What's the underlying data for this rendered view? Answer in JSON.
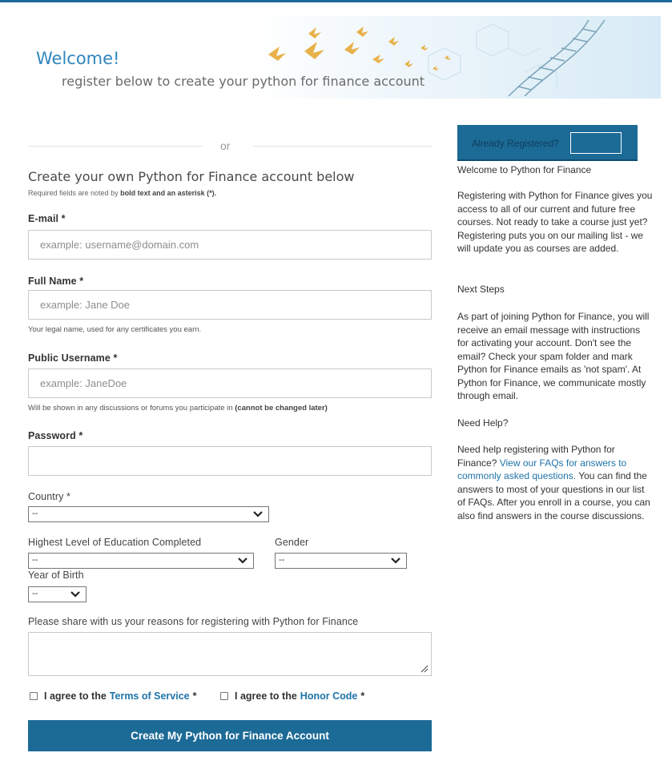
{
  "banner": {
    "welcome": "Welcome!",
    "tagline": "register below to create your python for finance account"
  },
  "divider": {
    "or": "or"
  },
  "form": {
    "title": "Create your own Python for Finance account below",
    "required_note_pre": "Required fields are noted by ",
    "required_note_bold": "bold text and an asterisk (*).",
    "email": {
      "label": "E-mail *",
      "placeholder": "example: username@domain.com",
      "value": ""
    },
    "full_name": {
      "label": "Full Name *",
      "placeholder": "example: Jane Doe",
      "value": "",
      "hint": "Your legal name, used for any certificates you earn."
    },
    "username": {
      "label": "Public Username *",
      "placeholder": "example: JaneDoe",
      "value": "",
      "hint_pre": "Will be shown in any discussions or forums you participate in ",
      "hint_bold": "(cannot be changed later)"
    },
    "password": {
      "label": "Password *",
      "value": ""
    },
    "country": {
      "label": "Country *",
      "selected": "--"
    },
    "education": {
      "label": "Highest Level of Education Completed",
      "selected": "--"
    },
    "gender": {
      "label": "Gender",
      "selected": "--"
    },
    "year_of_birth": {
      "label": "Year of Birth",
      "selected": "--"
    },
    "reasons": {
      "label": "Please share with us your reasons for registering with Python for Finance",
      "value": ""
    },
    "terms": {
      "pre": "I agree to the",
      "link": "Terms of Service",
      "post": "*"
    },
    "honor": {
      "pre": "I agree to the",
      "link": "Honor Code",
      "post": "*"
    },
    "submit_label": "Create My Python for Finance Account"
  },
  "sidebar": {
    "already_registered": "Already Registered?",
    "login_button": "",
    "welcome_heading": "Welcome to Python for Finance",
    "welcome_body": "Registering with Python for Finance gives you access to all of our current and future free courses. Not ready to take a course just yet? Registering puts you on our mailing list - we will update you as courses are added.",
    "next_heading": "Next Steps",
    "next_body": "As part of joining Python for Finance, you will receive an email message with instructions for activating your account. Don't see the email? Check your spam folder and mark Python for Finance emails as 'not spam'. At Python for Finance, we communicate mostly through email.",
    "help_heading": "Need Help?",
    "help_pre": "Need help registering with Python for Finance?",
    "help_link": "View our FAQs for answers to commonly asked questions.",
    "help_post": "You can find the answers to most of your questions in our list of FAQs. After you enroll in a course, you can also find answers in the course discussions."
  },
  "colors": {
    "accent": "#1c6a96",
    "link": "#1f73a8",
    "welcome": "#2f86bd"
  }
}
